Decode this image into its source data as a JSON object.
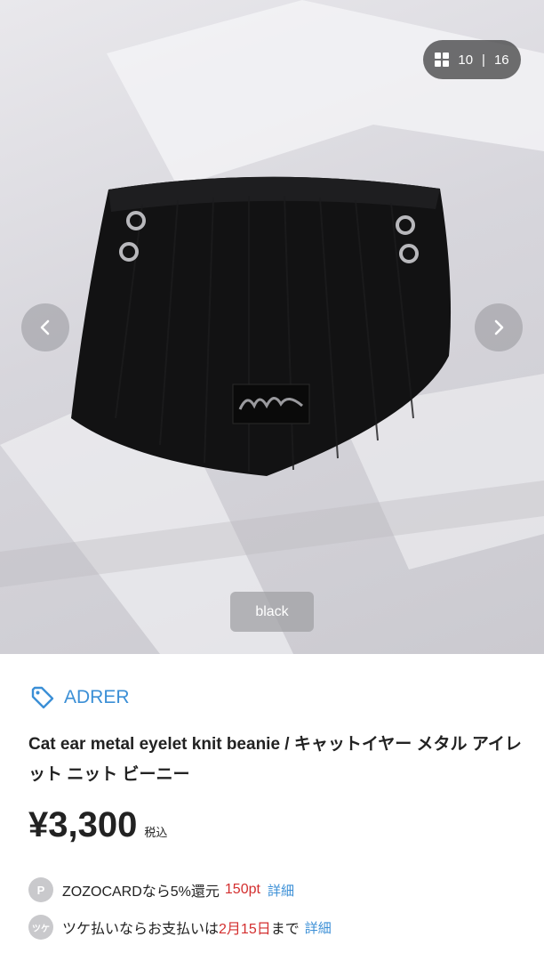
{
  "gallery": {
    "counter_current": "10",
    "counter_separator": "|",
    "counter_total": "16",
    "color_label": "black"
  },
  "product": {
    "brand": "ADRER",
    "title": "Cat ear metal eyelet knit beanie / キャットイヤー メタル アイレット ニット ビーニー",
    "price": "¥3,300",
    "tax_label": "税込"
  },
  "zozocard": {
    "badge": "P",
    "text_before": "ZOZOCARDなら5%還元",
    "points": "150pt",
    "link": "詳細"
  },
  "tsuke": {
    "badge": "ツケ",
    "text_before": "ツケ払いならお支払いは",
    "date": "2月15日",
    "text_after": "まで",
    "link": "詳細"
  },
  "colors": {
    "accent": "#3b8fd6",
    "highlight": "#d32f2f"
  }
}
